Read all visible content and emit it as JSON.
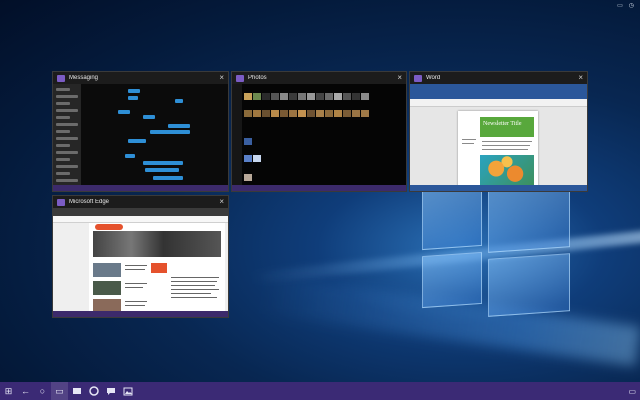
{
  "colors": {
    "accent": "#3b2a75",
    "word_blue": "#2b579a",
    "messaging_blue": "#2e8fd6"
  },
  "tray": {
    "notification_icon": "notification-icon",
    "clock_icon": "clock-icon"
  },
  "windows": {
    "messaging": {
      "title": "Messaging",
      "close": "×"
    },
    "photos": {
      "title": "Photos",
      "close": "×"
    },
    "word": {
      "title": "Word",
      "close": "×",
      "newsletter_title": "Newsletter Title"
    },
    "edge": {
      "title": "Microsoft Edge",
      "close": "×"
    }
  },
  "taskbar": {
    "start": "⊞",
    "back": "←",
    "cortana": "○",
    "task_view": "▭",
    "apps": [
      "messaging-app-icon",
      "edge-app-icon",
      "messaging-app-icon-2",
      "photos-app-icon"
    ],
    "action_center": "▭"
  }
}
